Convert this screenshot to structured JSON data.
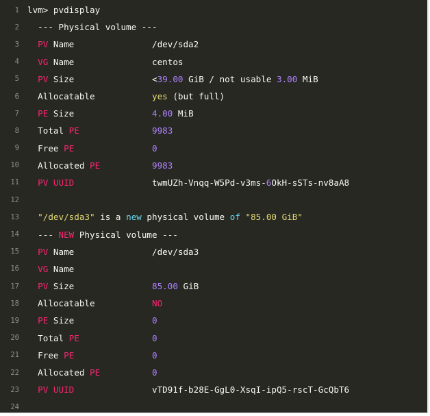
{
  "colors": {
    "background": "#272822",
    "line_number": "#8f908a",
    "plain": "#f8f8f2",
    "keyword": "#f92672",
    "number": "#ae81ff",
    "string": "#e6db74",
    "builtin": "#66d9ef"
  },
  "lines": [
    {
      "n": "1",
      "t": [
        {
          "c": "plain",
          "s": "lvm> pvdisplay"
        }
      ]
    },
    {
      "n": "2",
      "t": [
        {
          "c": "plain",
          "s": "  --- Physical volume ---"
        }
      ]
    },
    {
      "n": "3",
      "t": [
        {
          "c": "plain",
          "s": "  "
        },
        {
          "c": "kw",
          "s": "PV"
        },
        {
          "c": "plain",
          "s": " Name               /dev/sda2"
        }
      ]
    },
    {
      "n": "4",
      "t": [
        {
          "c": "plain",
          "s": "  "
        },
        {
          "c": "kw",
          "s": "VG"
        },
        {
          "c": "plain",
          "s": " Name               centos"
        }
      ]
    },
    {
      "n": "5",
      "t": [
        {
          "c": "plain",
          "s": "  "
        },
        {
          "c": "kw",
          "s": "PV"
        },
        {
          "c": "plain",
          "s": " Size               <"
        },
        {
          "c": "num",
          "s": "39.00"
        },
        {
          "c": "plain",
          "s": " GiB / not usable "
        },
        {
          "c": "num",
          "s": "3.00"
        },
        {
          "c": "plain",
          "s": " MiB"
        }
      ]
    },
    {
      "n": "6",
      "t": [
        {
          "c": "plain",
          "s": "  Allocatable           "
        },
        {
          "c": "str",
          "s": "yes"
        },
        {
          "c": "plain",
          "s": " (but full)"
        }
      ]
    },
    {
      "n": "7",
      "t": [
        {
          "c": "plain",
          "s": "  "
        },
        {
          "c": "kw",
          "s": "PE"
        },
        {
          "c": "plain",
          "s": " Size               "
        },
        {
          "c": "num",
          "s": "4.00"
        },
        {
          "c": "plain",
          "s": " MiB"
        }
      ]
    },
    {
      "n": "8",
      "t": [
        {
          "c": "plain",
          "s": "  Total "
        },
        {
          "c": "kw",
          "s": "PE"
        },
        {
          "c": "plain",
          "s": "              "
        },
        {
          "c": "num",
          "s": "9983"
        }
      ]
    },
    {
      "n": "9",
      "t": [
        {
          "c": "plain",
          "s": "  Free "
        },
        {
          "c": "kw",
          "s": "PE"
        },
        {
          "c": "plain",
          "s": "               "
        },
        {
          "c": "num",
          "s": "0"
        }
      ]
    },
    {
      "n": "10",
      "t": [
        {
          "c": "plain",
          "s": "  Allocated "
        },
        {
          "c": "kw",
          "s": "PE"
        },
        {
          "c": "plain",
          "s": "          "
        },
        {
          "c": "num",
          "s": "9983"
        }
      ]
    },
    {
      "n": "11",
      "t": [
        {
          "c": "plain",
          "s": "  "
        },
        {
          "c": "kw",
          "s": "PV UUID"
        },
        {
          "c": "plain",
          "s": "               twmUZh-Vnqq-W5Pd-v3ms-"
        },
        {
          "c": "num",
          "s": "6"
        },
        {
          "c": "plain",
          "s": "OkH-sSTs-nv8aA8"
        }
      ]
    },
    {
      "n": "12",
      "t": [
        {
          "c": "plain",
          "s": ""
        }
      ]
    },
    {
      "n": "13",
      "t": [
        {
          "c": "plain",
          "s": "  "
        },
        {
          "c": "str",
          "s": "\"/dev/sda3\""
        },
        {
          "c": "plain",
          "s": " is a "
        },
        {
          "c": "cyan",
          "s": "new"
        },
        {
          "c": "plain",
          "s": " physical volume "
        },
        {
          "c": "cyan",
          "s": "of"
        },
        {
          "c": "plain",
          "s": " "
        },
        {
          "c": "str",
          "s": "\"85.00 GiB\""
        }
      ]
    },
    {
      "n": "14",
      "t": [
        {
          "c": "plain",
          "s": "  --- "
        },
        {
          "c": "kw",
          "s": "NEW"
        },
        {
          "c": "plain",
          "s": " Physical volume ---"
        }
      ]
    },
    {
      "n": "15",
      "t": [
        {
          "c": "plain",
          "s": "  "
        },
        {
          "c": "kw",
          "s": "PV"
        },
        {
          "c": "plain",
          "s": " Name               /dev/sda3"
        }
      ]
    },
    {
      "n": "16",
      "t": [
        {
          "c": "plain",
          "s": "  "
        },
        {
          "c": "kw",
          "s": "VG"
        },
        {
          "c": "plain",
          "s": " Name"
        }
      ]
    },
    {
      "n": "17",
      "t": [
        {
          "c": "plain",
          "s": "  "
        },
        {
          "c": "kw",
          "s": "PV"
        },
        {
          "c": "plain",
          "s": " Size               "
        },
        {
          "c": "num",
          "s": "85.00"
        },
        {
          "c": "plain",
          "s": " GiB"
        }
      ]
    },
    {
      "n": "18",
      "t": [
        {
          "c": "plain",
          "s": "  Allocatable           "
        },
        {
          "c": "kw",
          "s": "NO"
        }
      ]
    },
    {
      "n": "19",
      "t": [
        {
          "c": "plain",
          "s": "  "
        },
        {
          "c": "kw",
          "s": "PE"
        },
        {
          "c": "plain",
          "s": " Size               "
        },
        {
          "c": "num",
          "s": "0"
        }
      ]
    },
    {
      "n": "20",
      "t": [
        {
          "c": "plain",
          "s": "  Total "
        },
        {
          "c": "kw",
          "s": "PE"
        },
        {
          "c": "plain",
          "s": "              "
        },
        {
          "c": "num",
          "s": "0"
        }
      ]
    },
    {
      "n": "21",
      "t": [
        {
          "c": "plain",
          "s": "  Free "
        },
        {
          "c": "kw",
          "s": "PE"
        },
        {
          "c": "plain",
          "s": "               "
        },
        {
          "c": "num",
          "s": "0"
        }
      ]
    },
    {
      "n": "22",
      "t": [
        {
          "c": "plain",
          "s": "  Allocated "
        },
        {
          "c": "kw",
          "s": "PE"
        },
        {
          "c": "plain",
          "s": "          "
        },
        {
          "c": "num",
          "s": "0"
        }
      ]
    },
    {
      "n": "23",
      "t": [
        {
          "c": "plain",
          "s": "  "
        },
        {
          "c": "kw",
          "s": "PV UUID"
        },
        {
          "c": "plain",
          "s": "               vTD91f-b28E-GgL0-XsqI-ipQ5-rscT-GcQbT6"
        }
      ]
    },
    {
      "n": "24",
      "t": [
        {
          "c": "plain",
          "s": ""
        }
      ]
    }
  ]
}
